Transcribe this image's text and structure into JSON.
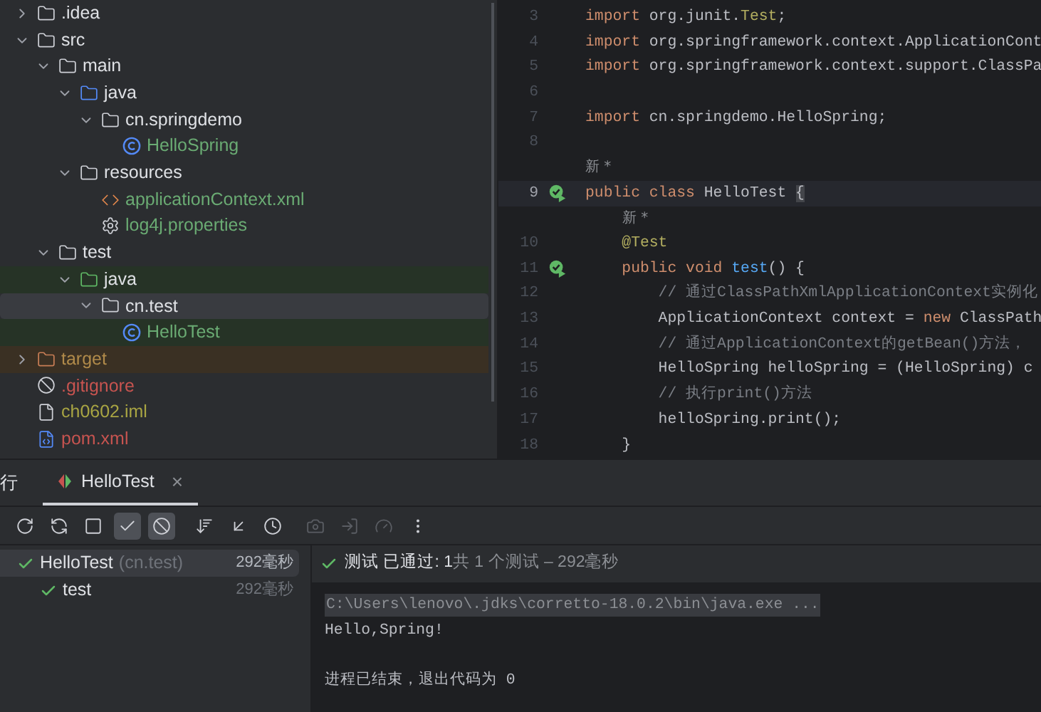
{
  "project_tree": [
    {
      "name": ".idea",
      "kind": "folder",
      "expanded": false,
      "selected": false
    },
    {
      "name": "src",
      "kind": "folder",
      "expanded": true,
      "selected": false,
      "children": [
        {
          "name": "main",
          "kind": "folder",
          "expanded": true,
          "selected": false,
          "children": [
            {
              "name": "java",
              "kind": "source_folder",
              "expanded": true,
              "selected": false,
              "children": [
                {
                  "name": "cn.springdemo",
                  "kind": "package",
                  "expanded": true,
                  "selected": false,
                  "children": [
                    {
                      "name": "HelloSpring",
                      "kind": "class",
                      "selected": false,
                      "color": "#6aab73"
                    }
                  ]
                }
              ]
            },
            {
              "name": "resources",
              "kind": "resource_folder",
              "expanded": true,
              "selected": false,
              "children": [
                {
                  "name": "applicationContext.xml",
                  "kind": "xml",
                  "selected": false,
                  "color": "#6aab73"
                },
                {
                  "name": "log4j.properties",
                  "kind": "properties",
                  "selected": false,
                  "color": "#6aab73"
                }
              ]
            }
          ]
        },
        {
          "name": "test",
          "kind": "folder",
          "expanded": true,
          "selected": false,
          "children": [
            {
              "name": "java",
              "kind": "test_folder",
              "expanded": true,
              "selected": false,
              "children": [
                {
                  "name": "cn.test",
                  "kind": "package",
                  "expanded": true,
                  "selected": true,
                  "children": [
                    {
                      "name": "HelloTest",
                      "kind": "class",
                      "selected": false,
                      "color": "#6aab73"
                    }
                  ]
                }
              ]
            }
          ]
        }
      ]
    },
    {
      "name": "target",
      "kind": "excluded_folder",
      "expanded": false,
      "selected": false,
      "color": "#b08a4a"
    },
    {
      "name": ".gitignore",
      "kind": "ignore_file",
      "selected": false,
      "color": "#c75450"
    },
    {
      "name": "ch0602.iml",
      "kind": "module_file",
      "selected": false,
      "color": "#a9a543"
    },
    {
      "name": "pom.xml",
      "kind": "build_file",
      "selected": false,
      "color": "#c75450"
    }
  ],
  "editor": {
    "lines": [
      {
        "kind": "code",
        "number": "3",
        "tokens": [
          {
            "kind": "keyword",
            "text": "import"
          },
          {
            "kind": "plain",
            "text": " org.junit."
          },
          {
            "kind": "annotation",
            "text": "Test"
          },
          {
            "kind": "plain",
            "text": ";"
          }
        ]
      },
      {
        "kind": "code",
        "number": "4",
        "tokens": [
          {
            "kind": "keyword",
            "text": "import"
          },
          {
            "kind": "plain",
            "text": " org.springframework.context.ApplicationCont"
          }
        ]
      },
      {
        "kind": "code",
        "number": "5",
        "tokens": [
          {
            "kind": "keyword",
            "text": "import"
          },
          {
            "kind": "plain",
            "text": " org.springframework.context.support.ClassPa"
          }
        ]
      },
      {
        "kind": "code",
        "number": "6"
      },
      {
        "kind": "code",
        "number": "7",
        "tokens": [
          {
            "kind": "keyword",
            "text": "import"
          },
          {
            "kind": "plain",
            "text": " cn.springdemo.HelloSpring;"
          }
        ]
      },
      {
        "kind": "code",
        "number": "8"
      },
      {
        "kind": "hint",
        "text": "新 *",
        "indent": false
      },
      {
        "kind": "code",
        "number": "9",
        "current": true,
        "test_passed": true,
        "tokens": [
          {
            "kind": "keyword",
            "text": "public class"
          },
          {
            "kind": "plain",
            "text": " HelloTest "
          },
          {
            "kind": "brace",
            "text": "{"
          }
        ]
      },
      {
        "kind": "hint",
        "text": "新 *",
        "indent": true
      },
      {
        "kind": "code",
        "number": "10",
        "tokens": [
          {
            "kind": "annotation",
            "text": "    @Test"
          }
        ]
      },
      {
        "kind": "code",
        "number": "11",
        "test_passed": true,
        "tokens": [
          {
            "kind": "keyword",
            "text": "    public void"
          },
          {
            "kind": "method",
            "text": " test"
          },
          {
            "kind": "plain",
            "text": "() {"
          }
        ]
      },
      {
        "kind": "code",
        "number": "12",
        "tokens": [
          {
            "kind": "comment",
            "text": "        // 通过ClassPathXmlApplicationContext实例化"
          }
        ]
      },
      {
        "kind": "code",
        "number": "13",
        "tokens": [
          {
            "kind": "plain",
            "text": "        ApplicationContext context = "
          },
          {
            "kind": "keyword",
            "text": "new"
          },
          {
            "kind": "plain",
            "text": " ClassPath"
          }
        ]
      },
      {
        "kind": "code",
        "number": "14",
        "tokens": [
          {
            "kind": "comment",
            "text": "        // 通过ApplicationContext的getBean()方法，"
          }
        ]
      },
      {
        "kind": "code",
        "number": "15",
        "tokens": [
          {
            "kind": "plain",
            "text": "        HelloSpring helloSpring = (HelloSpring) c"
          }
        ]
      },
      {
        "kind": "code",
        "number": "16",
        "tokens": [
          {
            "kind": "comment",
            "text": "        // 执行print()方法"
          }
        ]
      },
      {
        "kind": "code",
        "number": "17",
        "tokens": [
          {
            "kind": "plain",
            "text": "        helloSpring.print();"
          }
        ]
      },
      {
        "kind": "code",
        "number": "18",
        "tokens": [
          {
            "kind": "plain",
            "text": "    }"
          }
        ]
      }
    ]
  },
  "run_panel": {
    "title": "行",
    "tabs": [
      {
        "label": "HelloTest",
        "selected": true,
        "close": "×"
      }
    ],
    "toolbar": [
      {
        "kind": "rerun",
        "on": false,
        "disabled": false
      },
      {
        "kind": "rerun_failed",
        "on": false,
        "disabled": false
      },
      {
        "kind": "stop",
        "on": false,
        "disabled": false
      },
      {
        "kind": "show_passed",
        "on": true,
        "disabled": false
      },
      {
        "kind": "show_ignored",
        "on": true,
        "disabled": false
      },
      {
        "kind": "sort",
        "on": false,
        "disabled": false
      },
      {
        "kind": "import",
        "on": false,
        "disabled": false
      },
      {
        "kind": "history",
        "on": false,
        "disabled": false
      },
      {
        "kind": "snapshot",
        "on": false,
        "disabled": true
      },
      {
        "kind": "export",
        "on": false,
        "disabled": true
      },
      {
        "kind": "coverage",
        "on": false,
        "disabled": true
      },
      {
        "kind": "more",
        "on": false,
        "disabled": false
      }
    ],
    "tests": [
      {
        "name": "HelloTest",
        "detail": "(cn.test)",
        "duration": "292毫秒",
        "passed": true,
        "selected": true,
        "children": [
          {
            "name": "test",
            "duration": "292毫秒",
            "passed": true,
            "selected": false
          }
        ]
      }
    ],
    "status": {
      "passed": true,
      "label": "测试 已通过: 1",
      "summary": "共 1 个测试 – 292毫秒"
    },
    "console": [
      {
        "kind": "command",
        "text": "C:\\Users\\lenovo\\.jdks\\corretto-18.0.2\\bin\\java.exe ..."
      },
      {
        "kind": "output",
        "text": "Hello,Spring!"
      },
      {
        "kind": "blank"
      },
      {
        "kind": "exit",
        "text": "进程已结束，退出代码为 0"
      }
    ]
  }
}
